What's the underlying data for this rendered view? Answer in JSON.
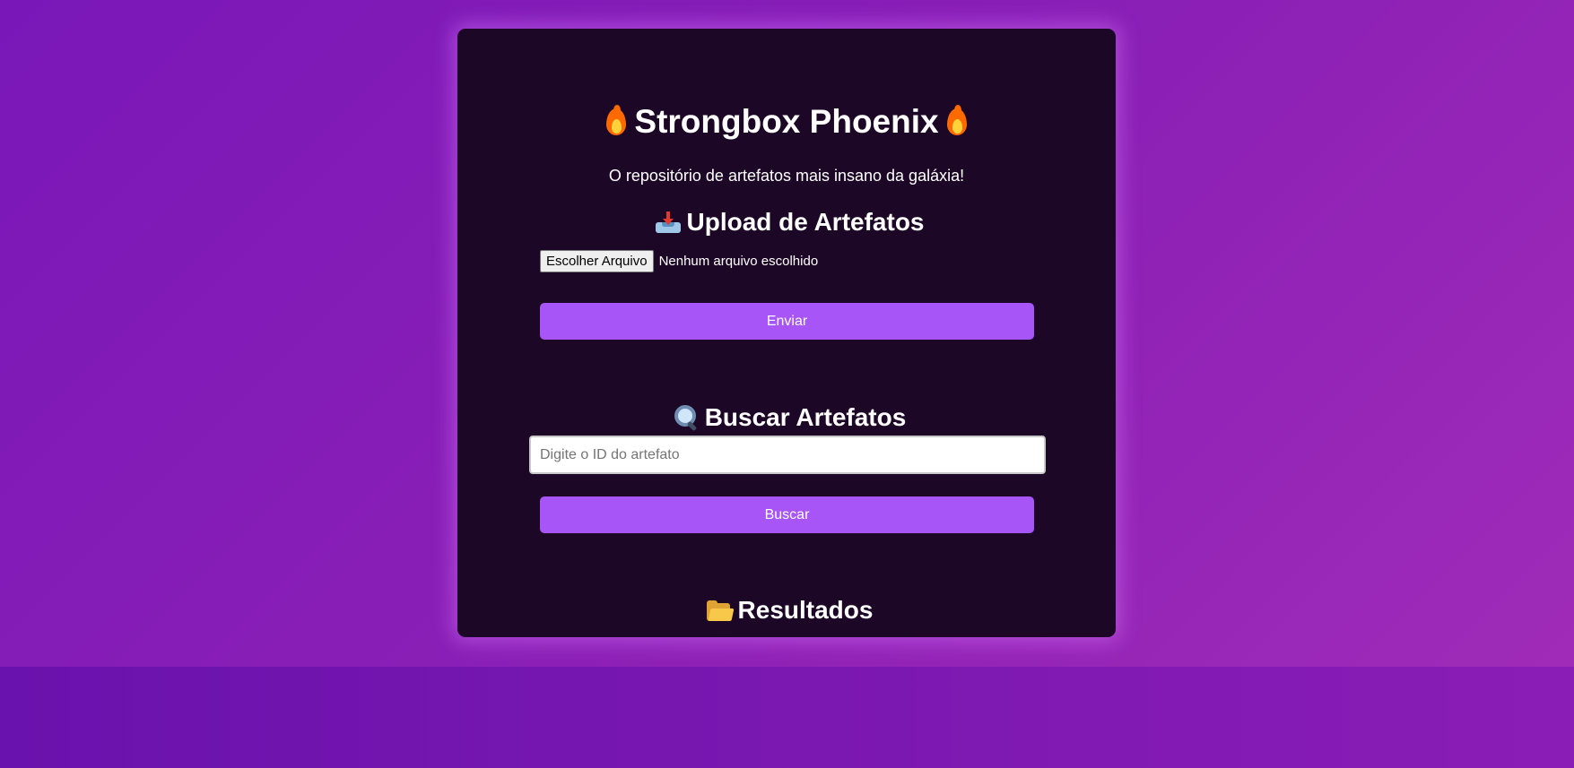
{
  "header": {
    "title": "Strongbox Phoenix",
    "subtitle": "O repositório de artefatos mais insano da galáxia!",
    "title_icon": "fire-icon"
  },
  "upload": {
    "heading": "Upload de Artefatos",
    "heading_icon": "inbox-tray-icon",
    "file_button_label": "Escolher Arquivo",
    "file_status": "Nenhum arquivo escolhido",
    "submit_label": "Enviar"
  },
  "search": {
    "heading": "Buscar Artefatos",
    "heading_icon": "magnifier-icon",
    "input_value": "",
    "input_placeholder": "Digite o ID do artefato",
    "submit_label": "Buscar"
  },
  "results": {
    "heading": "Resultados",
    "heading_icon": "open-folder-icon"
  },
  "colors": {
    "accent": "#a855f7",
    "card_background": "#1d0726",
    "page_background": "#8a1db5",
    "text": "#ffffff"
  }
}
